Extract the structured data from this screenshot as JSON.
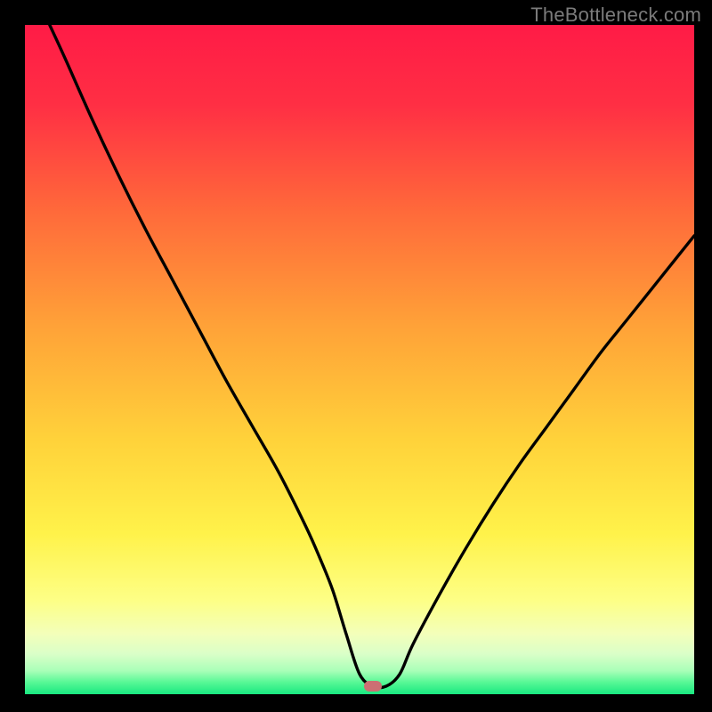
{
  "watermark": "TheBottleneck.com",
  "chart_data": {
    "type": "line",
    "title": "",
    "xlabel": "",
    "ylabel": "",
    "xlim": [
      0,
      100
    ],
    "ylim": [
      0,
      100
    ],
    "grid": false,
    "legend": false,
    "series": [
      {
        "name": "bottleneck-curve",
        "x": [
          3.7,
          6,
          10,
          14,
          18,
          22,
          26,
          30,
          34,
          38,
          42,
          44,
          46,
          48,
          50,
          52,
          54,
          56,
          58,
          62,
          66,
          70,
          74,
          78,
          82,
          86,
          90,
          94,
          98,
          100
        ],
        "y": [
          100,
          95,
          86,
          77.5,
          69.5,
          62,
          54.5,
          47,
          40,
          33,
          25,
          20.5,
          15.5,
          9,
          3,
          1.2,
          1.2,
          3,
          7.5,
          15,
          22,
          28.5,
          34.5,
          40,
          45.5,
          51,
          56,
          61,
          66,
          68.5
        ]
      }
    ],
    "marker": {
      "x": 52,
      "y": 1.2
    },
    "gradient_stops": [
      {
        "pct": 0,
        "color": "#ff1b46"
      },
      {
        "pct": 12,
        "color": "#ff2f44"
      },
      {
        "pct": 28,
        "color": "#ff6a3a"
      },
      {
        "pct": 45,
        "color": "#ffa238"
      },
      {
        "pct": 62,
        "color": "#ffd23a"
      },
      {
        "pct": 76,
        "color": "#fff24a"
      },
      {
        "pct": 86,
        "color": "#fdff86"
      },
      {
        "pct": 91,
        "color": "#f3ffba"
      },
      {
        "pct": 94,
        "color": "#daffc8"
      },
      {
        "pct": 96.5,
        "color": "#a9ffb8"
      },
      {
        "pct": 98.2,
        "color": "#58f896"
      },
      {
        "pct": 100,
        "color": "#19e880"
      }
    ]
  }
}
